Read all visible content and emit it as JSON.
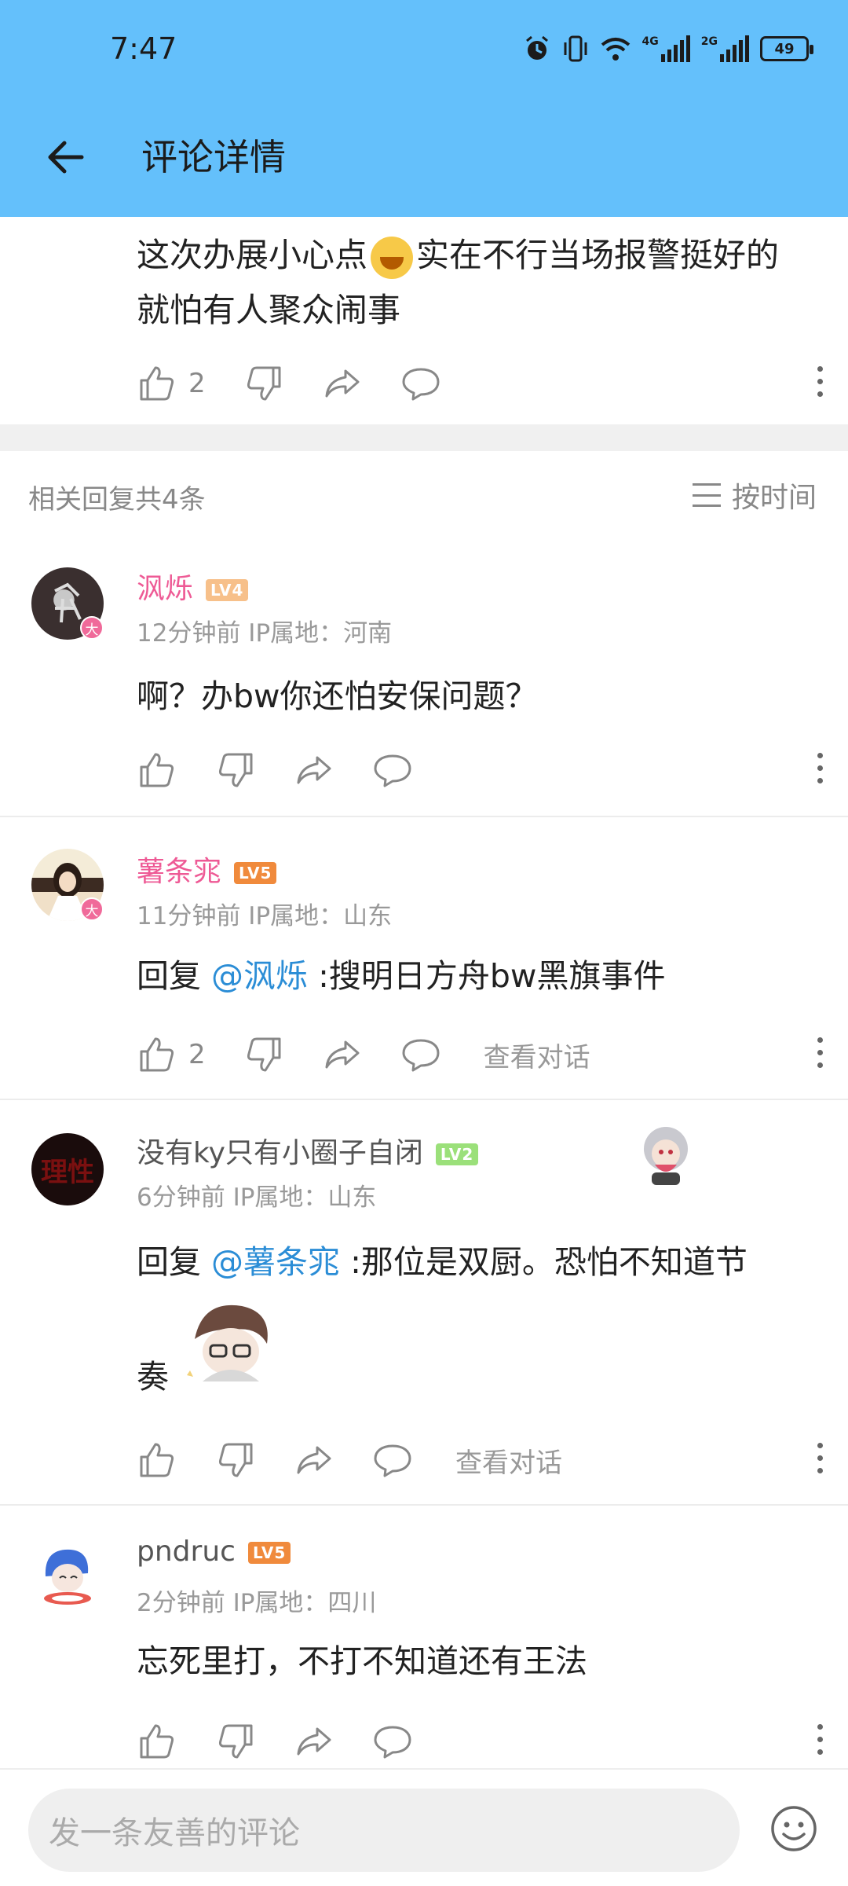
{
  "status_bar": {
    "time": "7:47",
    "net1": "4G",
    "net2": "2G",
    "battery": "49"
  },
  "header": {
    "title": "评论详情"
  },
  "top_comment": {
    "text_before": "这次办展小心点",
    "text_after": "实在不行当场报警挺好的 就怕有人聚众闹事",
    "likes": "2"
  },
  "replies_header": {
    "count_label": "相关回复共4条",
    "sort_label": "按时间"
  },
  "replies": [
    {
      "username": "沨烁",
      "level": "LV4",
      "level_color": "#f7c08a",
      "badge": "大",
      "meta": "12分钟前 IP属地：河南",
      "prefix": "",
      "mention": "",
      "text": "啊？办bw你还怕安保问题？",
      "likes": "",
      "view_conv": ""
    },
    {
      "username": "薯条宨",
      "level": "LV5",
      "level_color": "#f08a3c",
      "badge": "大",
      "meta": "11分钟前 IP属地：山东",
      "prefix": "回复 ",
      "mention": "@沨烁",
      "text": " :搜明日方舟bw黑旗事件",
      "likes": "2",
      "view_conv": "查看对话"
    },
    {
      "username": "没有ky只有小圈子自闭",
      "level": "LV2",
      "level_color": "#9be07a",
      "badge": "",
      "avatar_text": "理性",
      "meta": "6分钟前 IP属地：山东",
      "prefix": "回复 ",
      "mention": "@薯条宨",
      "text": " :那位是双厨。恐怕不知道节",
      "text2": "奏",
      "likes": "",
      "view_conv": "查看对话"
    },
    {
      "username": "pndruc",
      "level": "LV5",
      "level_color": "#f08a3c",
      "badge": "",
      "meta": "2分钟前 IP属地：四川",
      "prefix": "",
      "mention": "",
      "text": "忘死里打，不打不知道还有王法",
      "likes": "",
      "view_conv": ""
    }
  ],
  "input": {
    "placeholder": "发一条友善的评论"
  },
  "icons": [
    "back-arrow-icon",
    "like-icon",
    "dislike-icon",
    "share-icon",
    "comment-icon",
    "more-icon",
    "sort-icon",
    "emoji-icon"
  ]
}
